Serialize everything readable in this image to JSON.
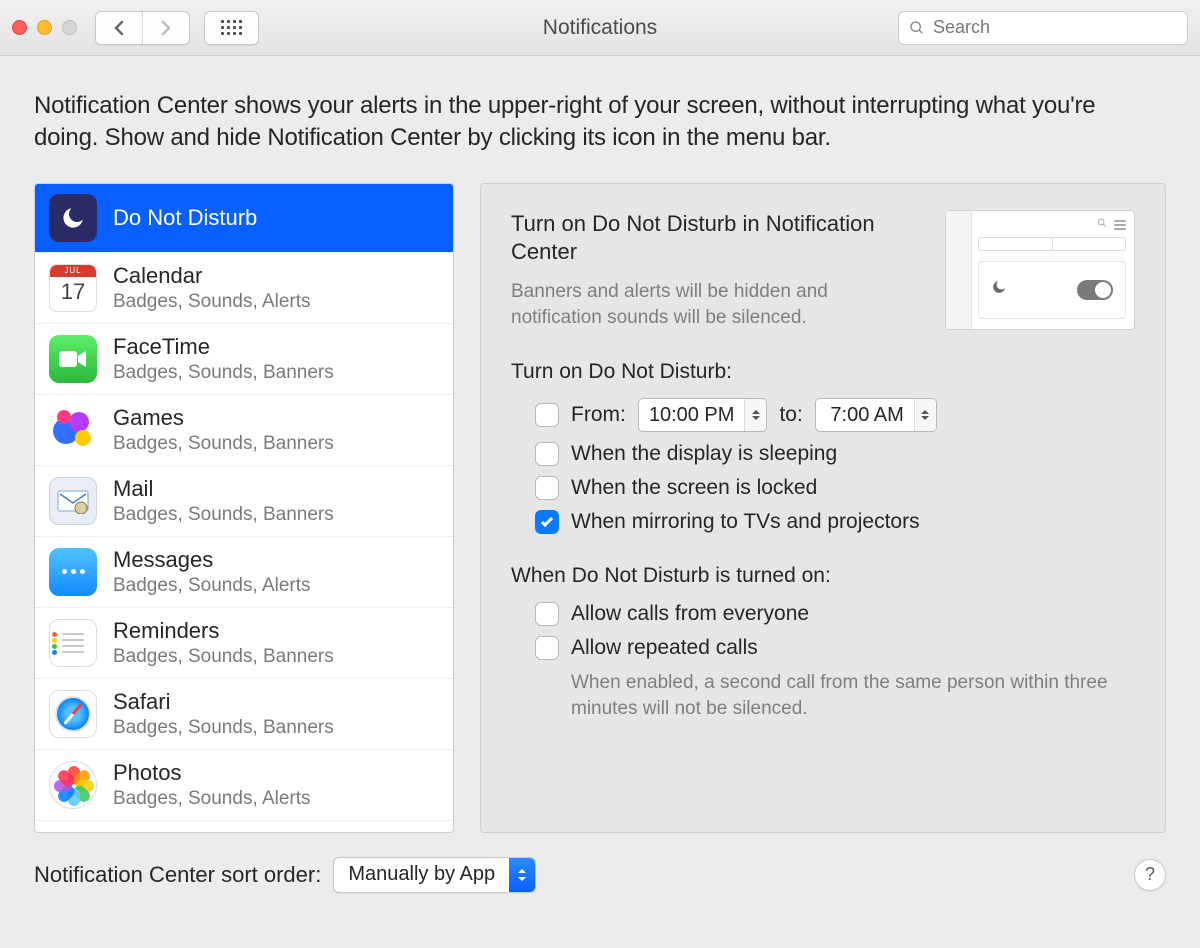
{
  "window": {
    "title": "Notifications",
    "search_placeholder": "Search"
  },
  "intro": "Notification Center shows your alerts in the upper-right of your screen, without interrupting what you're doing. Show and hide Notification Center by clicking its icon in the menu bar.",
  "apps": [
    {
      "name": "Do Not Disturb",
      "subtitle": "",
      "icon": "dnd",
      "selected": true
    },
    {
      "name": "Calendar",
      "subtitle": "Badges, Sounds, Alerts",
      "icon": "calendar"
    },
    {
      "name": "FaceTime",
      "subtitle": "Badges, Sounds, Banners",
      "icon": "facetime"
    },
    {
      "name": "Games",
      "subtitle": "Badges, Sounds, Banners",
      "icon": "games"
    },
    {
      "name": "Mail",
      "subtitle": "Badges, Sounds, Banners",
      "icon": "mail"
    },
    {
      "name": "Messages",
      "subtitle": "Badges, Sounds, Alerts",
      "icon": "messages"
    },
    {
      "name": "Reminders",
      "subtitle": "Badges, Sounds, Banners",
      "icon": "reminders"
    },
    {
      "name": "Safari",
      "subtitle": "Badges, Sounds, Banners",
      "icon": "safari"
    },
    {
      "name": "Photos",
      "subtitle": "Badges, Sounds, Alerts",
      "icon": "photos"
    }
  ],
  "calendar_icon": {
    "month": "JUL",
    "day": "17"
  },
  "dnd": {
    "heading": "Turn on Do Not Disturb in Notification Center",
    "heading_sub": "Banners and alerts will be hidden and notification sounds will be silenced.",
    "schedule_title": "Turn on Do Not Disturb:",
    "from_label": "From:",
    "from_value": "10:00 PM",
    "to_label": "to:",
    "to_value": "7:00 AM",
    "from_checked": false,
    "when_sleeping": "When the display is sleeping",
    "when_sleeping_checked": false,
    "when_locked": "When the screen is locked",
    "when_locked_checked": false,
    "when_mirroring": "When mirroring to TVs and projectors",
    "when_mirroring_checked": true,
    "when_on_title": "When Do Not Disturb is turned on:",
    "allow_everyone": "Allow calls from everyone",
    "allow_everyone_checked": false,
    "allow_repeated": "Allow repeated calls",
    "allow_repeated_checked": false,
    "allow_repeated_hint": "When enabled, a second call from the same person within three minutes will not be silenced."
  },
  "footer": {
    "sort_label": "Notification Center sort order:",
    "sort_value": "Manually by App",
    "help": "?"
  }
}
